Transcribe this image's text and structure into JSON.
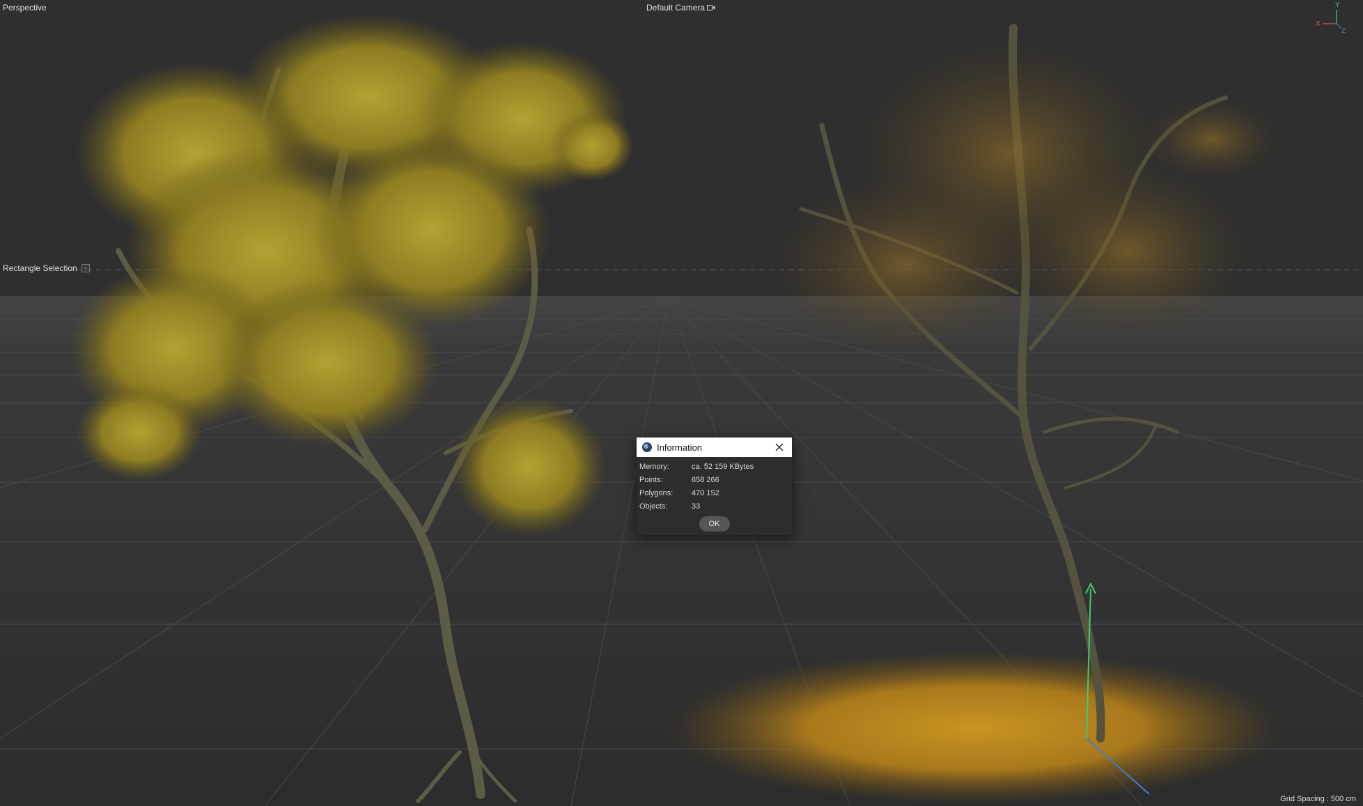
{
  "viewport": {
    "view_name": "Perspective",
    "camera_name": "Default Camera",
    "camera_icon": "camera-icon",
    "active_tool": "Rectangle Selection",
    "grid_spacing": "Grid Spacing : 500 cm",
    "axis": {
      "x": "X",
      "y": "Y",
      "z": "Z"
    },
    "colors": {
      "background": "#2f2f2f",
      "axis_x": "#d9534f",
      "axis_y": "#3ecf6b",
      "axis_z": "#3f7fd6",
      "foliage_left": "#9a8a2a",
      "foliage_right": "#b8861c",
      "trunk": "#5a5a45"
    }
  },
  "dialog": {
    "title": "Information",
    "icon": "cinema4d-app-icon",
    "rows": [
      {
        "key": "Memory:",
        "value": "ca. 52 159 KBytes"
      },
      {
        "key": "Points:",
        "value": "658 266"
      },
      {
        "key": "Polygons:",
        "value": "470 152"
      },
      {
        "key": "Objects:",
        "value": "33"
      }
    ],
    "ok_label": "OK"
  }
}
